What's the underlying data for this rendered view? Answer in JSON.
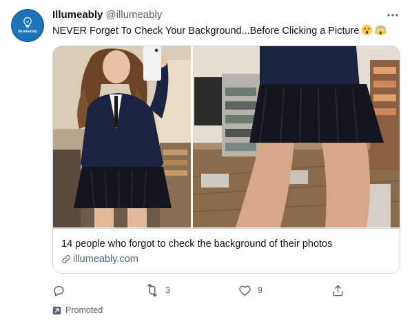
{
  "tweet": {
    "author": {
      "name": "Illumeably",
      "handle": "@illumeably",
      "avatar_text": "illumeably"
    },
    "text": "NEVER Forget To Check Your Background...Before Clicking a Picture",
    "emojis": [
      "astonished-face-emoji",
      "face-screaming-in-fear-emoji"
    ],
    "card": {
      "title": "14 people who forgot to check the background of their photos",
      "domain": "illumeably.com"
    },
    "actions": {
      "reply_count": "",
      "retweet_count": "3",
      "like_count": "9"
    },
    "promoted_label": "Promoted"
  },
  "colors": {
    "text_primary": "#0f1419",
    "text_secondary": "#536471",
    "border": "#cfd9de",
    "avatar_bg": "#1d74b8"
  },
  "icons": [
    "more-icon",
    "link-icon",
    "reply-icon",
    "retweet-icon",
    "like-icon",
    "share-icon",
    "promoted-icon"
  ]
}
